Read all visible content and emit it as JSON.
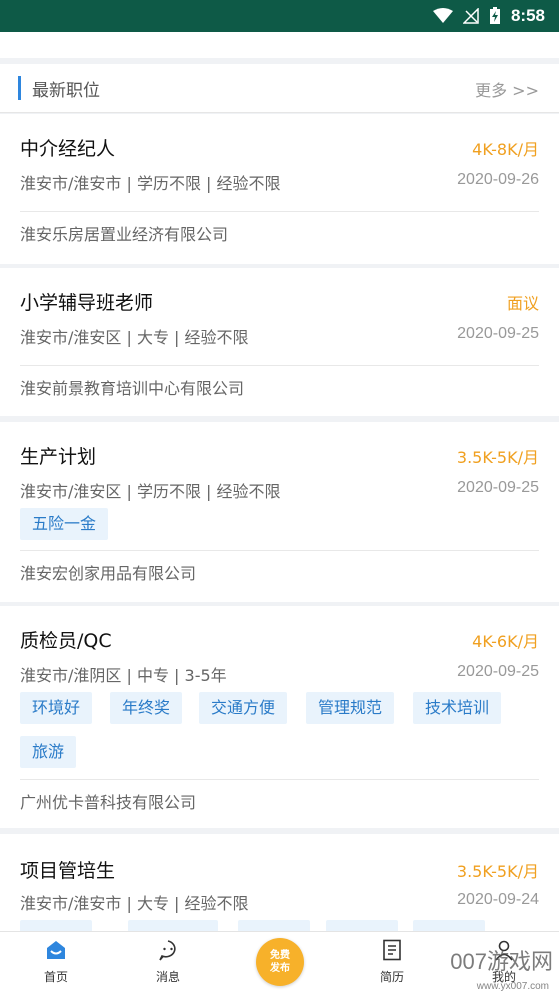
{
  "status_bar": {
    "time": "8:58"
  },
  "section": {
    "title": "最新职位",
    "more": "更多 >>"
  },
  "jobs": [
    {
      "title": "中介经纪人",
      "salary": "4K-8K/月",
      "location": "淮安市/淮安市 | 学历不限 | 经验不限",
      "date": "2020-09-26",
      "tags": [],
      "company": "淮安乐房居置业经济有限公司"
    },
    {
      "title": "小学辅导班老师",
      "salary": "面议",
      "location": "淮安市/淮安区 | 大专 | 经验不限",
      "date": "2020-09-25",
      "tags": [],
      "company": "淮安前景教育培训中心有限公司"
    },
    {
      "title": "生产计划",
      "salary": "3.5K-5K/月",
      "location": "淮安市/淮安区 | 学历不限 | 经验不限",
      "date": "2020-09-25",
      "tags": [
        "五险一金"
      ],
      "company": "淮安宏创家用品有限公司"
    },
    {
      "title": "质检员/QC",
      "salary": "4K-6K/月",
      "location": "淮安市/淮阴区 | 中专 | 3-5年",
      "date": "2020-09-25",
      "tags": [
        "环境好",
        "年终奖",
        "交通方便",
        "管理规范",
        "技术培训",
        "旅游"
      ],
      "company": "广州优卡普科技有限公司"
    },
    {
      "title": "项目管培生",
      "salary": "3.5K-5K/月",
      "location": "淮安市/淮安市 | 大专 | 经验不限",
      "date": "2020-09-24",
      "tags": [],
      "company": ""
    }
  ],
  "tabbar": {
    "home": "首页",
    "messages": "消息",
    "publish_line1": "免费",
    "publish_line2": "发布",
    "resume": "简历",
    "mine": "我的"
  },
  "watermark": {
    "brand": "007游戏网",
    "url": "www.yx007.com"
  },
  "colors": {
    "status_bar": "#0e5a47",
    "accent": "#2e86de",
    "salary": "#f0a020",
    "publish": "#f7b12a"
  }
}
